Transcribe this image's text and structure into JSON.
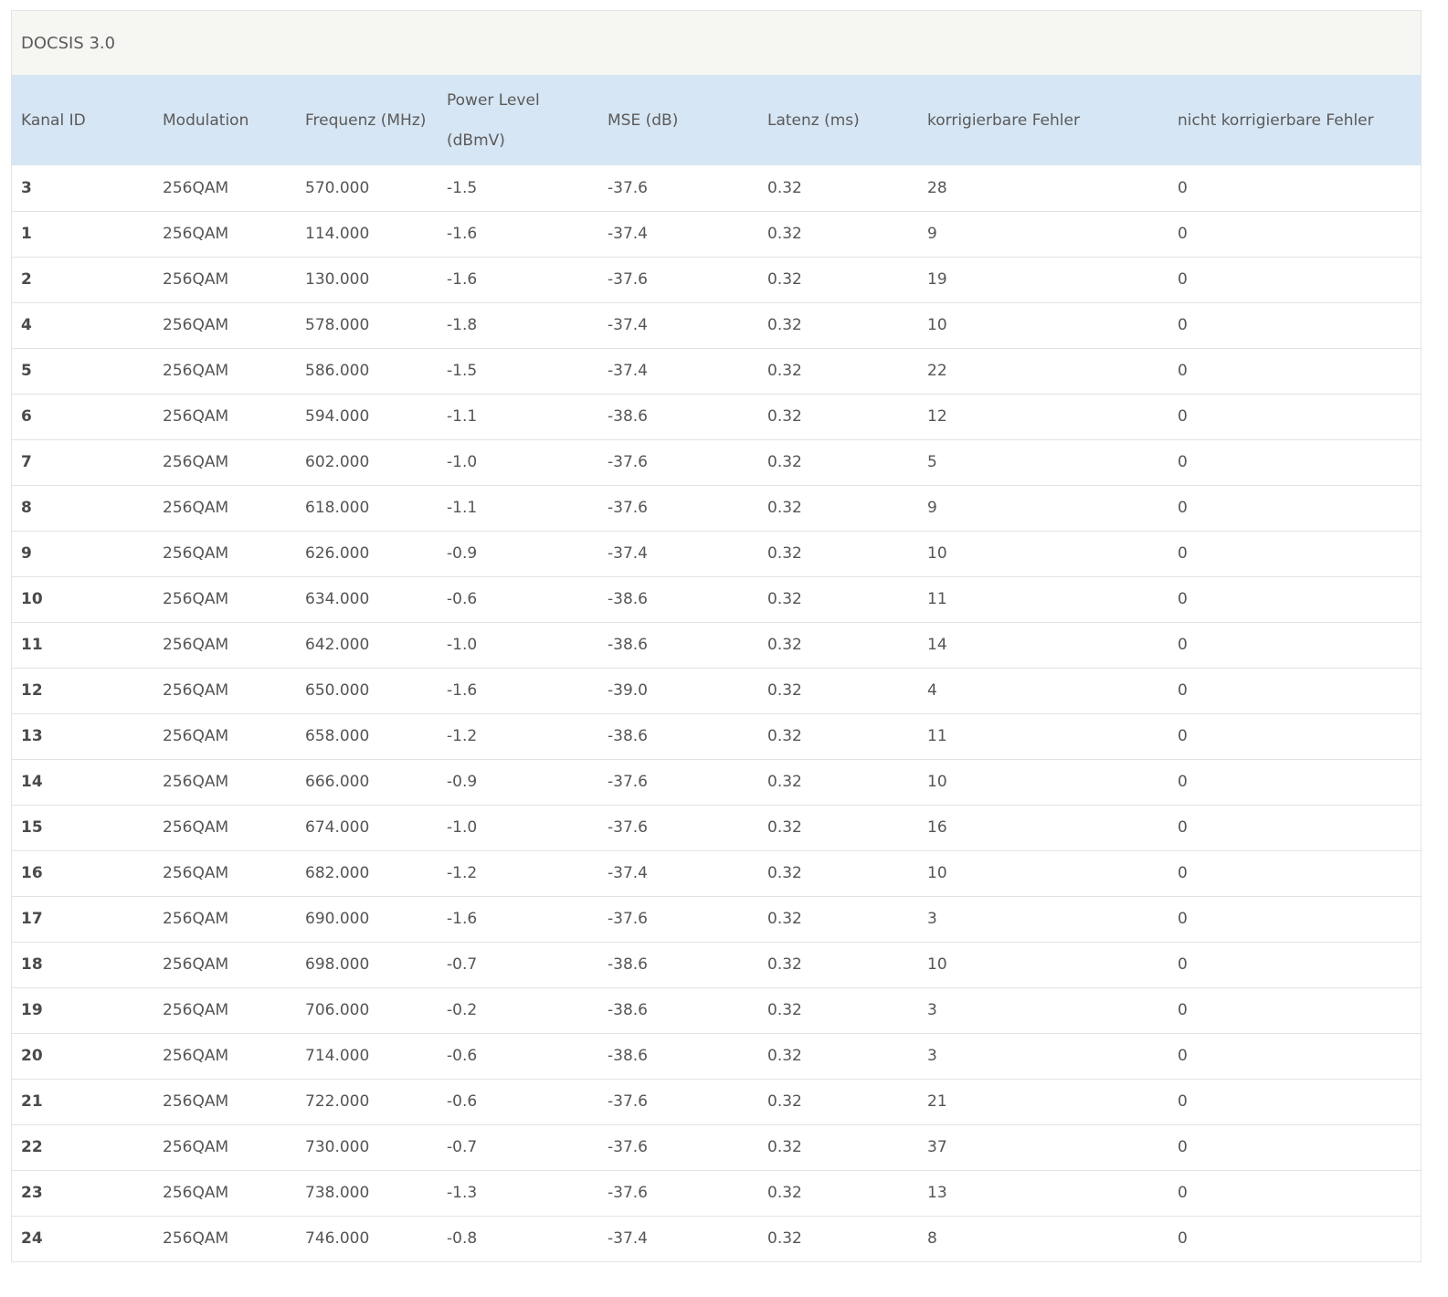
{
  "panel": {
    "title": "DOCSIS 3.0"
  },
  "table": {
    "headers": {
      "kanal_id": "Kanal ID",
      "modulation": "Modulation",
      "frequenz": "Frequenz (MHz)",
      "power_line1": "Power Level",
      "power_line2": "(dBmV)",
      "mse": "MSE (dB)",
      "latenz": "Latenz (ms)",
      "korr": "korrigierbare Fehler",
      "nicht_korr": "nicht korrigierbare Fehler"
    },
    "rows": [
      {
        "id": "3",
        "modulation": "256QAM",
        "freq": "570.000",
        "power": "-1.5",
        "mse": "-37.6",
        "latency": "0.32",
        "corr": "28",
        "uncorr": "0"
      },
      {
        "id": "1",
        "modulation": "256QAM",
        "freq": "114.000",
        "power": "-1.6",
        "mse": "-37.4",
        "latency": "0.32",
        "corr": "9",
        "uncorr": "0"
      },
      {
        "id": "2",
        "modulation": "256QAM",
        "freq": "130.000",
        "power": "-1.6",
        "mse": "-37.6",
        "latency": "0.32",
        "corr": "19",
        "uncorr": "0"
      },
      {
        "id": "4",
        "modulation": "256QAM",
        "freq": "578.000",
        "power": "-1.8",
        "mse": "-37.4",
        "latency": "0.32",
        "corr": "10",
        "uncorr": "0"
      },
      {
        "id": "5",
        "modulation": "256QAM",
        "freq": "586.000",
        "power": "-1.5",
        "mse": "-37.4",
        "latency": "0.32",
        "corr": "22",
        "uncorr": "0"
      },
      {
        "id": "6",
        "modulation": "256QAM",
        "freq": "594.000",
        "power": "-1.1",
        "mse": "-38.6",
        "latency": "0.32",
        "corr": "12",
        "uncorr": "0"
      },
      {
        "id": "7",
        "modulation": "256QAM",
        "freq": "602.000",
        "power": "-1.0",
        "mse": "-37.6",
        "latency": "0.32",
        "corr": "5",
        "uncorr": "0"
      },
      {
        "id": "8",
        "modulation": "256QAM",
        "freq": "618.000",
        "power": "-1.1",
        "mse": "-37.6",
        "latency": "0.32",
        "corr": "9",
        "uncorr": "0"
      },
      {
        "id": "9",
        "modulation": "256QAM",
        "freq": "626.000",
        "power": "-0.9",
        "mse": "-37.4",
        "latency": "0.32",
        "corr": "10",
        "uncorr": "0"
      },
      {
        "id": "10",
        "modulation": "256QAM",
        "freq": "634.000",
        "power": "-0.6",
        "mse": "-38.6",
        "latency": "0.32",
        "corr": "11",
        "uncorr": "0"
      },
      {
        "id": "11",
        "modulation": "256QAM",
        "freq": "642.000",
        "power": "-1.0",
        "mse": "-38.6",
        "latency": "0.32",
        "corr": "14",
        "uncorr": "0"
      },
      {
        "id": "12",
        "modulation": "256QAM",
        "freq": "650.000",
        "power": "-1.6",
        "mse": "-39.0",
        "latency": "0.32",
        "corr": "4",
        "uncorr": "0"
      },
      {
        "id": "13",
        "modulation": "256QAM",
        "freq": "658.000",
        "power": "-1.2",
        "mse": "-38.6",
        "latency": "0.32",
        "corr": "11",
        "uncorr": "0"
      },
      {
        "id": "14",
        "modulation": "256QAM",
        "freq": "666.000",
        "power": "-0.9",
        "mse": "-37.6",
        "latency": "0.32",
        "corr": "10",
        "uncorr": "0"
      },
      {
        "id": "15",
        "modulation": "256QAM",
        "freq": "674.000",
        "power": "-1.0",
        "mse": "-37.6",
        "latency": "0.32",
        "corr": "16",
        "uncorr": "0"
      },
      {
        "id": "16",
        "modulation": "256QAM",
        "freq": "682.000",
        "power": "-1.2",
        "mse": "-37.4",
        "latency": "0.32",
        "corr": "10",
        "uncorr": "0"
      },
      {
        "id": "17",
        "modulation": "256QAM",
        "freq": "690.000",
        "power": "-1.6",
        "mse": "-37.6",
        "latency": "0.32",
        "corr": "3",
        "uncorr": "0"
      },
      {
        "id": "18",
        "modulation": "256QAM",
        "freq": "698.000",
        "power": "-0.7",
        "mse": "-38.6",
        "latency": "0.32",
        "corr": "10",
        "uncorr": "0"
      },
      {
        "id": "19",
        "modulation": "256QAM",
        "freq": "706.000",
        "power": "-0.2",
        "mse": "-38.6",
        "latency": "0.32",
        "corr": "3",
        "uncorr": "0"
      },
      {
        "id": "20",
        "modulation": "256QAM",
        "freq": "714.000",
        "power": "-0.6",
        "mse": "-38.6",
        "latency": "0.32",
        "corr": "3",
        "uncorr": "0"
      },
      {
        "id": "21",
        "modulation": "256QAM",
        "freq": "722.000",
        "power": "-0.6",
        "mse": "-37.6",
        "latency": "0.32",
        "corr": "21",
        "uncorr": "0"
      },
      {
        "id": "22",
        "modulation": "256QAM",
        "freq": "730.000",
        "power": "-0.7",
        "mse": "-37.6",
        "latency": "0.32",
        "corr": "37",
        "uncorr": "0"
      },
      {
        "id": "23",
        "modulation": "256QAM",
        "freq": "738.000",
        "power": "-1.3",
        "mse": "-37.6",
        "latency": "0.32",
        "corr": "13",
        "uncorr": "0"
      },
      {
        "id": "24",
        "modulation": "256QAM",
        "freq": "746.000",
        "power": "-0.8",
        "mse": "-37.4",
        "latency": "0.32",
        "corr": "8",
        "uncorr": "0"
      }
    ]
  }
}
